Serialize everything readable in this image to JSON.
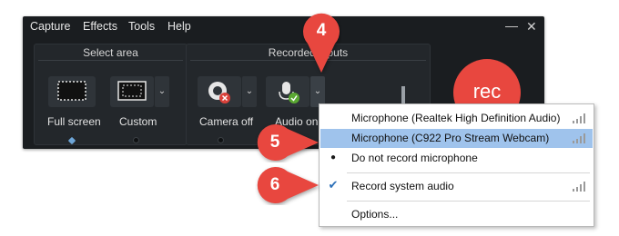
{
  "menubar": {
    "items": [
      "Capture",
      "Effects",
      "Tools",
      "Help"
    ]
  },
  "select_area": {
    "title": "Select area",
    "full_screen_label": "Full screen",
    "custom_label": "Custom"
  },
  "recorded_inputs": {
    "title": "Recorded inputs",
    "camera_label": "Camera off",
    "audio_label": "Audio on"
  },
  "rec_label": "rec",
  "audio_menu": {
    "items": [
      {
        "label": "Microphone (Realtek High Definition Audio)",
        "mark": "",
        "selected": false
      },
      {
        "label": "Microphone (C922 Pro Stream Webcam)",
        "mark": "",
        "selected": true
      },
      {
        "label": "Do not record microphone",
        "mark": "●",
        "selected": false
      },
      {
        "label": "Record system audio",
        "mark": "✔",
        "selected": false
      },
      {
        "label": "Options...",
        "mark": "",
        "selected": false
      }
    ]
  },
  "callouts": [
    "4",
    "5",
    "6"
  ],
  "colors": {
    "accent": "#e8473f",
    "selection": "#9fc3ec",
    "panel": "#1a1d20"
  }
}
